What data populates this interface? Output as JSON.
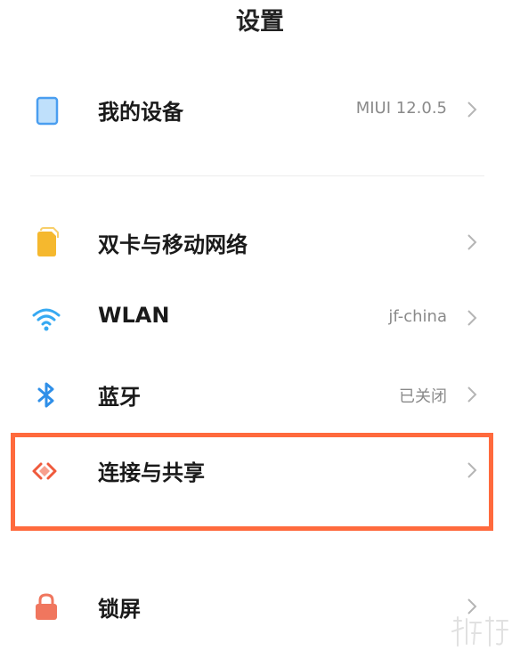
{
  "header": {
    "title": "设置"
  },
  "items": [
    {
      "id": "my-device",
      "label": "我的设备",
      "value": "MIUI 12.0.5",
      "icon": "tablet-icon",
      "color": "#4a9ef0"
    },
    {
      "id": "sim-network",
      "label": "双卡与移动网络",
      "value": "",
      "icon": "sim-card-icon",
      "color": "#f5b82e"
    },
    {
      "id": "wlan",
      "label": "WLAN",
      "value": "jf-china",
      "icon": "wifi-icon",
      "color": "#36a9f2"
    },
    {
      "id": "bluetooth",
      "label": "蓝牙",
      "value": "已关闭",
      "icon": "bluetooth-icon",
      "color": "#2f8fe8"
    },
    {
      "id": "connection-sharing",
      "label": "连接与共享",
      "value": "",
      "icon": "connection-sharing-icon",
      "color": "#ef5a3c"
    },
    {
      "id": "lock-screen",
      "label": "锁屏",
      "value": "",
      "icon": "lock-icon",
      "color": "#f0765e"
    }
  ],
  "highlight_color": "#ff6a3d"
}
